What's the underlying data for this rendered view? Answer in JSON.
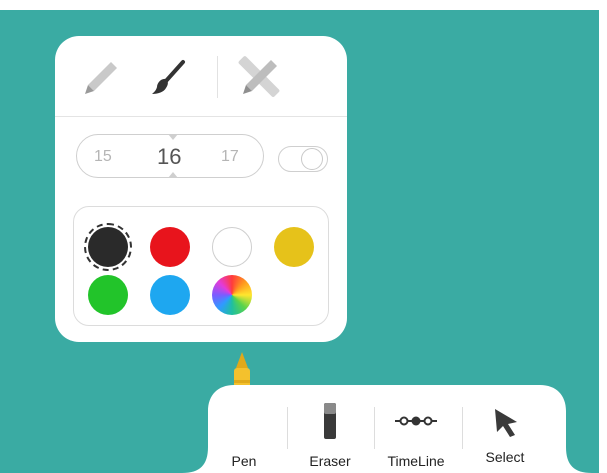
{
  "pen_panel": {
    "tools": [
      {
        "name": "pencil",
        "icon": "pencil-icon"
      },
      {
        "name": "brush",
        "icon": "brush-icon"
      },
      {
        "name": "ruler-pen",
        "icon": "ruler-pencil-icon"
      }
    ],
    "size": {
      "prev": "15",
      "current": "16",
      "next": "17"
    },
    "toggle": {
      "on": false
    },
    "colors": [
      {
        "name": "black",
        "hex": "#2a2a2a",
        "selected": true
      },
      {
        "name": "red",
        "hex": "#e8141c"
      },
      {
        "name": "white",
        "hex": "#ffffff"
      },
      {
        "name": "yellow",
        "hex": "#e6c21a"
      },
      {
        "name": "green",
        "hex": "#22c42a"
      },
      {
        "name": "blue",
        "hex": "#1ea7f0"
      },
      {
        "name": "custom",
        "icon": "color-wheel-icon"
      }
    ]
  },
  "active_tool_indicator": {
    "icon": "crayon-icon",
    "color": "#f4c12d"
  },
  "toolbar": {
    "items": [
      {
        "label": "Pen",
        "icon": "crayon-icon"
      },
      {
        "label": "Eraser",
        "icon": "eraser-icon"
      },
      {
        "label": "TimeLine",
        "icon": "timeline-icon"
      },
      {
        "label": "Select",
        "icon": "cursor-icon"
      }
    ]
  },
  "colors": {
    "background": "#3aaba3",
    "panel": "#ffffff",
    "accent": "#f4c12d"
  }
}
